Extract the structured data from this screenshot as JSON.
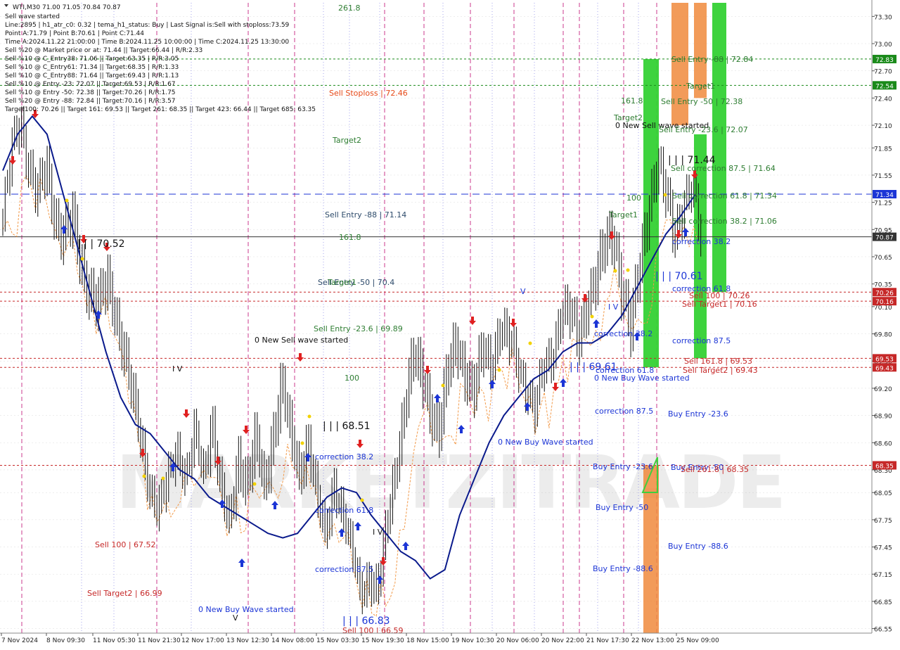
{
  "header": {
    "symbol_line": "WTI,M30  71.00 71.05 70.84 70.87",
    "info_lines": [
      "Sell wave started",
      "Line:2895 | h1_atr_c0: 0.32 | tema_h1_status: Buy | Last Signal is:Sell with stoploss:73.59",
      "Point A:71.79 | Point B:70.61 | Point C:71.44",
      "Time A:2024.11.22 21:00:00 | Time B:2024.11.25 10:00:00 | Time C:2024.11.25 13:30:00",
      "Sell %20 @ Market price or at: 71.44 || Target:66.44 | R/R:2.33",
      "Sell %10 @ C_Entry38: 71.06 || Target:63.35 | R/R:3.05",
      "Sell %10 @ C_Entry61: 71.34 || Target:68.35 | R/R:1.33",
      "Sell %10 @ C_Entry88: 71.64 || Target:69.43 | R/R:1.13",
      "Sell %10 @ Entry -23: 72.07 || Target:69.53 | R/R:1.67",
      "Sell %10 @ Entry -50: 72.38 || Target:70.26 | R/R:1.75",
      "Sell %20 @ Entry -88: 72.84 || Target:70.16 | R/R:3.57",
      "Target100: 70.26 || Target 161: 69.53 || Target 261: 68.35 || Target 423: 66.44 || Target 685: 63.35"
    ]
  },
  "watermark": "MARKETZITRADE",
  "chart_data": {
    "type": "candlestick",
    "timeframe": "M30",
    "symbol": "WTI",
    "ylim": [
      66.5,
      73.45
    ],
    "y_ticks": [
      73.3,
      73.0,
      72.7,
      72.4,
      72.1,
      71.85,
      71.55,
      71.25,
      70.95,
      70.65,
      70.35,
      70.1,
      69.8,
      69.5,
      69.2,
      68.9,
      68.6,
      68.3,
      68.05,
      67.75,
      67.45,
      67.15,
      66.85,
      66.55
    ],
    "x_labels": [
      "7 Nov 2024",
      "8 Nov 09:30",
      "11 Nov 05:30",
      "11 Nov 21:30",
      "12 Nov 17:00",
      "13 Nov 12:30",
      "14 Nov 08:00",
      "15 Nov 03:30",
      "15 Nov 19:30",
      "18 Nov 15:00",
      "19 Nov 10:30",
      "20 Nov 06:00",
      "20 Nov 22:00",
      "21 Nov 17:30",
      "22 Nov 13:00",
      "25 Nov 09:00"
    ],
    "price_levels": [
      {
        "value": 72.83,
        "label": "72.83",
        "color": "#1a8a1a",
        "style": "dotted"
      },
      {
        "value": 72.54,
        "label": "72.54",
        "color": "#1a8a1a",
        "style": "dotted"
      },
      {
        "value": 71.34,
        "label": "71.34",
        "color": "#1c35d6",
        "style": "dashed"
      },
      {
        "value": 70.87,
        "label": "70.87",
        "color": "#333333",
        "style": "solid"
      },
      {
        "value": 70.26,
        "label": "70.26",
        "color": "#c62828",
        "style": "dotted"
      },
      {
        "value": 70.16,
        "label": "70.16",
        "color": "#c62828",
        "style": "dotted"
      },
      {
        "value": 69.53,
        "label": "69.53",
        "color": "#c62828",
        "style": "dotted"
      },
      {
        "value": 69.43,
        "label": "69.43",
        "color": "#c62828",
        "style": "dotted"
      },
      {
        "value": 68.35,
        "label": "68.35",
        "color": "#c62828",
        "style": "dotted"
      }
    ],
    "close_path": [
      71.1,
      71.8,
      72.2,
      71.7,
      71.3,
      71.6,
      71.1,
      70.9,
      71.0,
      70.5,
      70.3,
      70.1,
      70.3,
      70.0,
      69.6,
      69.0,
      68.5,
      68.1,
      67.9,
      68.2,
      68.6,
      68.3,
      68.7,
      68.2,
      68.9,
      68.1,
      67.6,
      68.4,
      68.2,
      68.6,
      68.0,
      68.7,
      69.3,
      68.6,
      68.2,
      68.7,
      68.0,
      67.5,
      68.2,
      67.9,
      67.4,
      66.95,
      67.2,
      67.0,
      67.6,
      68.3,
      69.0,
      69.5,
      69.3,
      69.0,
      68.7,
      69.3,
      69.7,
      69.4,
      69.1,
      69.6,
      69.5,
      69.9,
      69.7,
      69.5,
      69.3,
      69.0,
      69.4,
      69.6,
      70.1,
      70.0,
      69.7,
      70.2,
      70.4,
      70.7,
      70.9,
      70.3,
      69.8,
      70.5,
      71.2,
      71.7,
      71.3,
      70.9,
      71.3,
      71.44,
      70.87
    ],
    "ma_line": [
      71.6,
      72.0,
      72.2,
      72.0,
      71.4,
      70.8,
      70.2,
      69.6,
      69.1,
      68.8,
      68.7,
      68.5,
      68.3,
      68.2,
      68.0,
      67.9,
      67.8,
      67.7,
      67.6,
      67.55,
      67.6,
      67.8,
      68.0,
      68.1,
      68.05,
      67.8,
      67.6,
      67.4,
      67.3,
      67.1,
      67.2,
      67.8,
      68.2,
      68.6,
      68.9,
      69.1,
      69.3,
      69.4,
      69.6,
      69.7,
      69.7,
      69.8,
      70.0,
      70.3,
      70.6,
      70.9,
      71.1,
      71.34
    ],
    "zones": [
      {
        "type": "green",
        "price_from": 69.43,
        "price_to": 72.83
      },
      {
        "type": "orange",
        "price_from": 66.5,
        "price_to": 68.35
      },
      {
        "type": "orange",
        "price_from": 72.1,
        "price_to": 73.45
      },
      {
        "type": "orange",
        "price_from": 72.4,
        "price_to": 73.45
      },
      {
        "type": "green",
        "price_from": 69.53,
        "price_to": 72.0
      },
      {
        "type": "green",
        "price_from": 70.26,
        "price_to": 73.45
      }
    ],
    "annotations": [
      {
        "text": "261.8",
        "color": "#2e7d32"
      },
      {
        "text": "Sell Stoploss | 72.46",
        "color": "#e64a19"
      },
      {
        "text": "Target2",
        "color": "#2e7d32"
      },
      {
        "text": "Sell Entry -88 | 71.14",
        "color": "#2e4b6b"
      },
      {
        "text": "161.8",
        "color": "#2e7d32"
      },
      {
        "text": "Sell Entry -50 | 70.4",
        "color": "#2e4b6b"
      },
      {
        "text": "Target1",
        "color": "#2e7d32"
      },
      {
        "text": "Sell Entry -23.6 | 69.89",
        "color": "#2e7d32"
      },
      {
        "text": "0 New Sell wave started",
        "color": "#111111"
      },
      {
        "text": "100",
        "color": "#2e7d32"
      },
      {
        "text": "| | | 68.51",
        "color": "#111111"
      },
      {
        "text": "correction 38.2",
        "color": "#1c35d6"
      },
      {
        "text": "correction 61.8",
        "color": "#1c35d6"
      },
      {
        "text": "correction 87.5",
        "color": "#1c35d6"
      },
      {
        "text": "| | | 66.83",
        "color": "#1c35d6"
      },
      {
        "text": "Sell 100 | 66.59",
        "color": "#c62828"
      },
      {
        "text": "0 New Buy Wave started",
        "color": "#1c35d6"
      },
      {
        "text": "Sell 100 | 67.52",
        "color": "#c62828"
      },
      {
        "text": "Sell Target2 | 66.99",
        "color": "#c62828"
      },
      {
        "text": "| | | 70.52",
        "color": "#111111"
      },
      {
        "text": "I V",
        "color": "#111111"
      },
      {
        "text": "V",
        "color": "#1c35d6"
      },
      {
        "text": "I V",
        "color": "#111111"
      },
      {
        "text": "V",
        "color": "#111111"
      },
      {
        "text": "0 New Buy Wave started",
        "color": "#1c35d6"
      },
      {
        "text": "161.8",
        "color": "#2e7d32"
      },
      {
        "text": "Target2",
        "color": "#2e7d32"
      },
      {
        "text": "0 New Sell wave started",
        "color": "#111111"
      },
      {
        "text": "100",
        "color": "#2e7d32"
      },
      {
        "text": "Target1",
        "color": "#2e7d32"
      },
      {
        "text": "correction 38.2",
        "color": "#1c35d6"
      },
      {
        "text": "| | | 69.61",
        "color": "#1c35d6"
      },
      {
        "text": "correction 61.8",
        "color": "#1c35d6"
      },
      {
        "text": "0 New Buy Wave started",
        "color": "#1c35d6"
      },
      {
        "text": "correction 87.5",
        "color": "#1c35d6"
      },
      {
        "text": "Buy Entry -23.6",
        "color": "#1c35d6"
      },
      {
        "text": "Buy Entry -50",
        "color": "#1c35d6"
      },
      {
        "text": "Buy Entry -88.6",
        "color": "#1c35d6"
      },
      {
        "text": "I V",
        "color": "#1c35d6"
      },
      {
        "text": "Sell Entry -88 | 72.84",
        "color": "#2e7d32"
      },
      {
        "text": "Target1",
        "color": "#2e7d32"
      },
      {
        "text": "Sell Entry -50 | 72.38",
        "color": "#2e7d32"
      },
      {
        "text": "Sell Entry -23.6 | 72.07",
        "color": "#2e7d32"
      },
      {
        "text": "| | | 71.44",
        "color": "#111111"
      },
      {
        "text": "Sell correction 87.5 | 71.64",
        "color": "#2e7d32"
      },
      {
        "text": "Sell correction 61.8 | 71.34",
        "color": "#2e7d32"
      },
      {
        "text": "Sell correction 38.2 | 71.06",
        "color": "#2e7d32"
      },
      {
        "text": "correction 38.2",
        "color": "#1c35d6"
      },
      {
        "text": "| | | 70.61",
        "color": "#1c35d6"
      },
      {
        "text": "correction 61.8",
        "color": "#1c35d6"
      },
      {
        "text": "Sell 100 | 70.26",
        "color": "#c62828"
      },
      {
        "text": "Sell Target1 | 70.16",
        "color": "#c62828"
      },
      {
        "text": "correction 87.5",
        "color": "#1c35d6"
      },
      {
        "text": "Sell 161.8 | 69.53",
        "color": "#c62828"
      },
      {
        "text": "Sell Target2 | 69.43",
        "color": "#c62828"
      },
      {
        "text": "Buy Entry -23.6",
        "color": "#1c35d6"
      },
      {
        "text": "Buy Entry -50",
        "color": "#1c35d6"
      },
      {
        "text": "Sell 261.8 | 68.35",
        "color": "#c62828"
      },
      {
        "text": "Buy Entry -88.6",
        "color": "#1c35d6"
      }
    ],
    "colors": {
      "price_axis_bg": "#ffffff",
      "grid": "#dddddd",
      "candle": "#111111",
      "ma": "#0a1a8c",
      "support_orange": "#f29a4a",
      "zone_green": "#34d134",
      "zone_orange": "#f08a3c",
      "magenta_vline": "#c2187a",
      "buy_arrow": "#1c35d6",
      "sell_arrow": "#e02020"
    }
  }
}
